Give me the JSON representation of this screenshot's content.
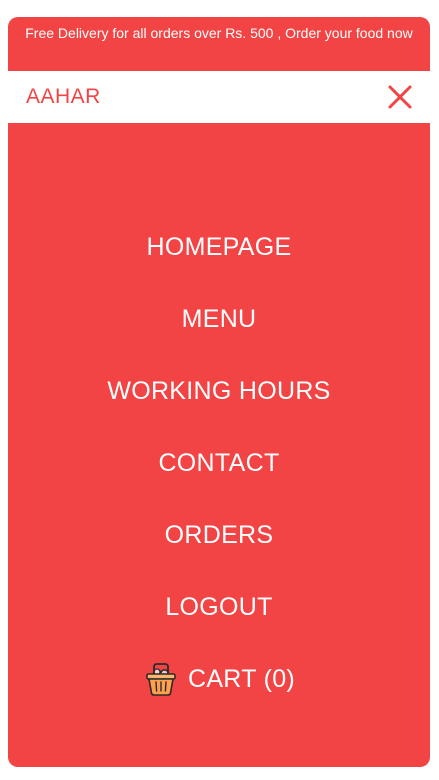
{
  "banner": {
    "text": "Free Delivery for all orders over Rs. 500 , Order your food now"
  },
  "header": {
    "brand": "AAHAR",
    "close_icon": "close-icon"
  },
  "menu": {
    "items": [
      {
        "label": "HOMEPAGE"
      },
      {
        "label": "MENU"
      },
      {
        "label": "WORKING HOURS"
      },
      {
        "label": "CONTACT"
      },
      {
        "label": "ORDERS"
      },
      {
        "label": "LOGOUT"
      }
    ],
    "cart": {
      "label": "CART (0)",
      "icon": "shopping-basket-icon"
    }
  },
  "colors": {
    "accent": "#f24444",
    "background": "#ffffff",
    "text_on_accent": "#ffffff"
  }
}
